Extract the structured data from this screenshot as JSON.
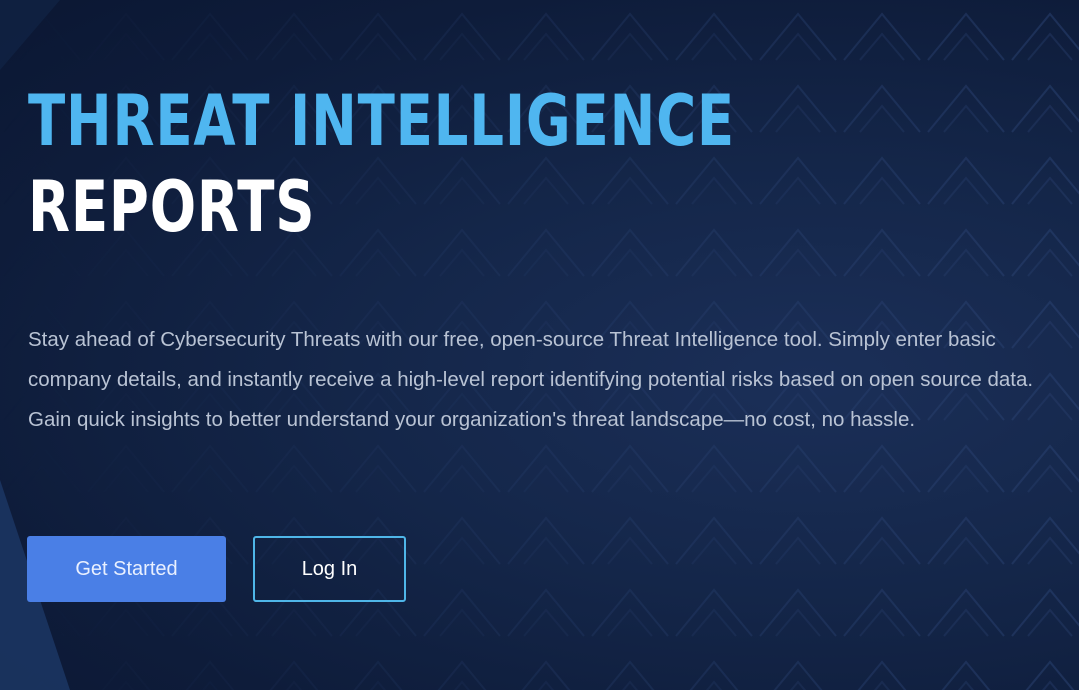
{
  "hero": {
    "title_line1": "THREAT INTELLIGENCE",
    "title_line2": "REPORTS",
    "description": "Stay ahead of Cybersecurity Threats with our free, open-source Threat Intelligence tool. Simply enter basic company details, and instantly receive a high-level report identifying potential risks based on open source data. Gain quick insights to better understand your organization's threat landscape—no cost, no hassle."
  },
  "actions": {
    "get_started_label": "Get Started",
    "log_in_label": "Log In"
  },
  "colors": {
    "background": "#0e1c3a",
    "title_accent": "#4fb6f0",
    "title_secondary": "#ffffff",
    "primary_button": "#4a7fe6",
    "secondary_button_border": "#4fb6e8",
    "body_text": "#b9c3d4"
  }
}
